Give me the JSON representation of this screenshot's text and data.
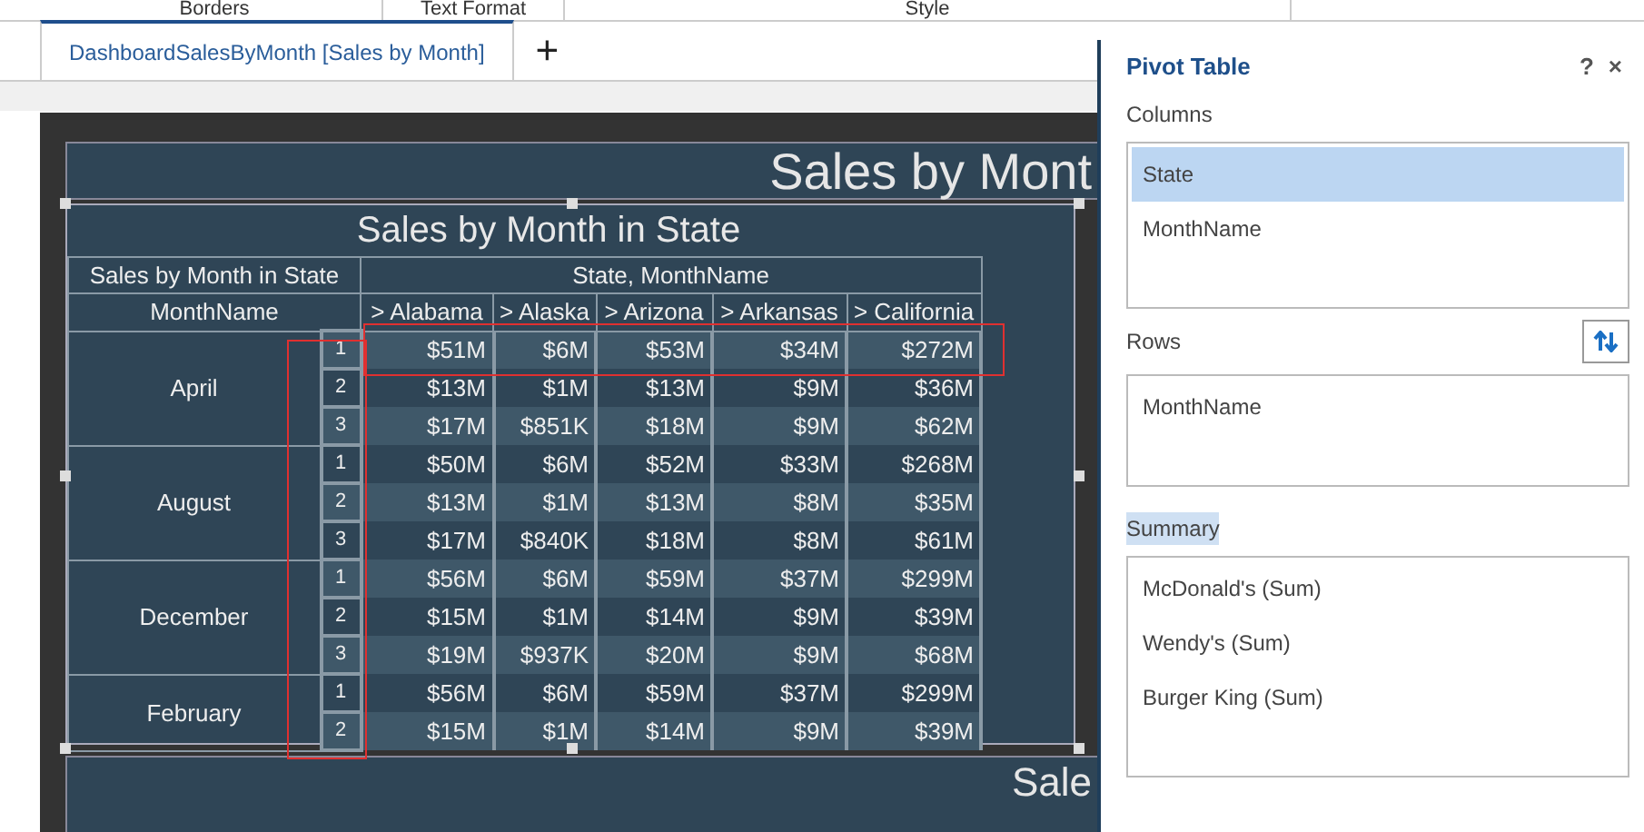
{
  "ribbon": {
    "groups": [
      "Borders",
      "Text Format",
      "Style"
    ]
  },
  "tabs": [
    {
      "label": "DashboardSalesByMonth [Sales by Month]",
      "selected": true
    }
  ],
  "add_tab": "+",
  "canvas": {
    "title": "Sales by Mont",
    "bottom_title": "Sale",
    "pivot": {
      "title": "Sales by Month in State",
      "corner_label": "Sales by Month in State",
      "column_group_label": "State, MonthName",
      "row_header": "MonthName",
      "index_highlighted": true,
      "columns": [
        "> Alabama",
        "> Alaska",
        "> Arizona",
        "> Arkansas",
        "> California"
      ],
      "groups": [
        {
          "month": "April",
          "rows": [
            {
              "index": "1",
              "selected": true,
              "values": [
                "$51M",
                "$6M",
                "$53M",
                "$34M",
                "$272M"
              ]
            },
            {
              "index": "2",
              "selected": false,
              "values": [
                "$13M",
                "$1M",
                "$13M",
                "$9M",
                "$36M"
              ]
            },
            {
              "index": "3",
              "selected": false,
              "values": [
                "$17M",
                "$851K",
                "$18M",
                "$9M",
                "$62M"
              ]
            }
          ]
        },
        {
          "month": "August",
          "rows": [
            {
              "index": "1",
              "selected": false,
              "values": [
                "$50M",
                "$6M",
                "$52M",
                "$33M",
                "$268M"
              ]
            },
            {
              "index": "2",
              "selected": false,
              "values": [
                "$13M",
                "$1M",
                "$13M",
                "$8M",
                "$35M"
              ]
            },
            {
              "index": "3",
              "selected": false,
              "values": [
                "$17M",
                "$840K",
                "$18M",
                "$8M",
                "$61M"
              ]
            }
          ]
        },
        {
          "month": "December",
          "rows": [
            {
              "index": "1",
              "selected": false,
              "values": [
                "$56M",
                "$6M",
                "$59M",
                "$37M",
                "$299M"
              ]
            },
            {
              "index": "2",
              "selected": false,
              "values": [
                "$15M",
                "$1M",
                "$14M",
                "$9M",
                "$39M"
              ]
            },
            {
              "index": "3",
              "selected": false,
              "values": [
                "$19M",
                "$937K",
                "$20M",
                "$9M",
                "$68M"
              ]
            }
          ]
        },
        {
          "month": "February",
          "rows": [
            {
              "index": "1",
              "selected": false,
              "values": [
                "$56M",
                "$6M",
                "$59M",
                "$37M",
                "$299M"
              ]
            },
            {
              "index": "2",
              "selected": false,
              "values": [
                "$15M",
                "$1M",
                "$14M",
                "$9M",
                "$39M"
              ]
            }
          ]
        }
      ]
    }
  },
  "panel": {
    "title": "Pivot Table",
    "help": "?",
    "close": "×",
    "columns": {
      "label": "Columns",
      "items": [
        {
          "label": "State",
          "selected": true
        },
        {
          "label": "MonthName",
          "selected": false
        }
      ]
    },
    "rows": {
      "label": "Rows",
      "items": [
        {
          "label": "MonthName",
          "selected": false
        }
      ]
    },
    "summary": {
      "label": "Summary",
      "highlighted": true,
      "items": [
        {
          "label": "McDonald's (Sum)",
          "selected": false
        },
        {
          "label": "Wendy's (Sum)",
          "selected": false
        },
        {
          "label": "Burger King (Sum)",
          "selected": false
        }
      ]
    }
  }
}
